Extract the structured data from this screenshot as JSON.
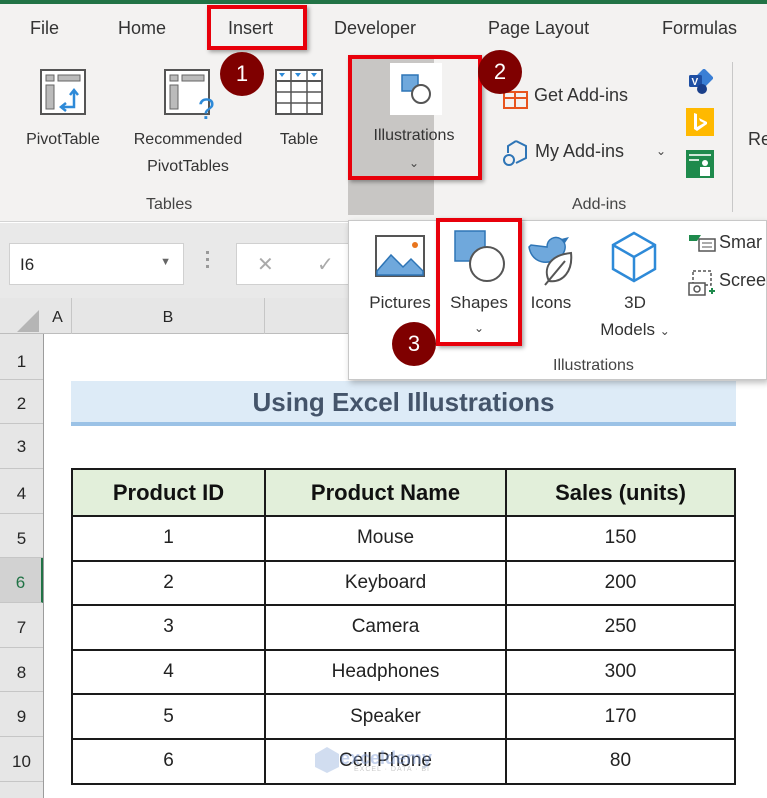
{
  "tabs": [
    "File",
    "Home",
    "Insert",
    "Developer",
    "Page Layout",
    "Formulas"
  ],
  "active_tab": "Insert",
  "ribbon": {
    "tables_group": {
      "label": "Tables",
      "pivot_table": "PivotTable",
      "recommended_line1": "Recommended",
      "recommended_line2": "PivotTables",
      "table": "Table"
    },
    "illustrations_button": "Illustrations",
    "addins_group": {
      "label": "Add-ins",
      "get_addins": "Get Add-ins",
      "my_addins": "My Add-ins"
    },
    "truncated_next": "Re"
  },
  "illustrations_dropdown": {
    "label": "Illustrations",
    "pictures": "Pictures",
    "shapes": "Shapes",
    "icons": "Icons",
    "models_line1": "3D",
    "models_line2": "Models",
    "smartart": "Smar",
    "screenshot": "Scree"
  },
  "badges": [
    "1",
    "2",
    "3"
  ],
  "formula_bar": {
    "name_box": "I6",
    "cancel_symbol": "✕",
    "enter_symbol": "✓"
  },
  "columns": [
    "A",
    "B"
  ],
  "rows": [
    "1",
    "2",
    "3",
    "4",
    "5",
    "6",
    "7",
    "8",
    "9",
    "10"
  ],
  "active_row": "6",
  "sheet": {
    "title": "Using Excel Illustrations",
    "headers": [
      "Product ID",
      "Product Name",
      "Sales (units)"
    ],
    "data": [
      [
        "1",
        "Mouse",
        "150"
      ],
      [
        "2",
        "Keyboard",
        "200"
      ],
      [
        "3",
        "Camera",
        "250"
      ],
      [
        "4",
        "Headphones",
        "300"
      ],
      [
        "5",
        "Speaker",
        "170"
      ],
      [
        "6",
        "Cell Phone",
        "80"
      ]
    ]
  },
  "watermark": {
    "name": "exceldemy",
    "tagline": "EXCEL · DATA · BI"
  },
  "colors": {
    "excel_green": "#217346",
    "highlight_red": "#e8000b",
    "badge": "#7f0000",
    "title_fill": "#ddebf7",
    "header_fill": "#e2efda"
  }
}
